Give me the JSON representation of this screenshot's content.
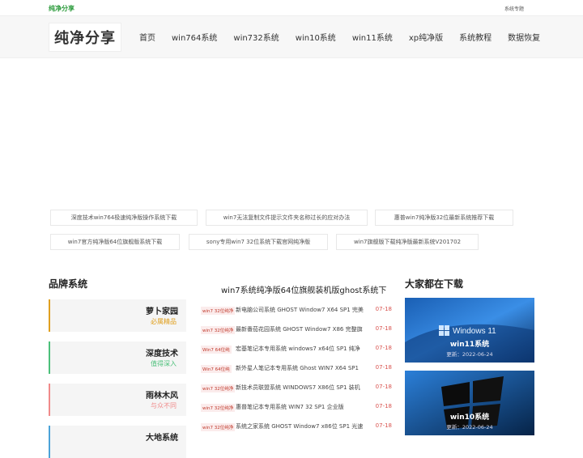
{
  "topbar": {
    "site_name": "纯净分享",
    "special_link": "系统专题"
  },
  "header": {
    "logo": "纯净分享"
  },
  "nav": [
    "首页",
    "win764系统",
    "win732系统",
    "win10系统",
    "win11系统",
    "xp纯净版",
    "系统教程",
    "数据恢复"
  ],
  "tags": [
    "深度技术win764极速纯净版操作系统下载",
    "win7无法复制文件提示文件夹名称过长的应对办法",
    "惠普win7纯净版32位最新系统推荐下载",
    "win7官方纯净版64位旗舰版系统下载",
    "sony专用win7 32位系统下载官网纯净版",
    "win7旗舰版下载纯净版最新系统V201702"
  ],
  "brands": {
    "title": "品牌系统",
    "items": [
      {
        "name": "萝卜家园",
        "sub": "必属精品",
        "color": "#e0a020"
      },
      {
        "name": "深度技术",
        "sub": "值得深入",
        "color": "#4cc07a"
      },
      {
        "name": "雨林木风",
        "sub": "与众不同",
        "color": "#f08a8a"
      },
      {
        "name": "大地系统",
        "sub": "",
        "color": "#4ba3d8"
      }
    ]
  },
  "list": {
    "title": "win7系统纯净版64位旗舰装机版ghost系统下",
    "rows": [
      {
        "badge": "win7 32位纯净",
        "title": "新电脑公司系统 GHOST Window7 X64 SP1 完美",
        "date": "07-18"
      },
      {
        "badge": "win7 32位纯净",
        "title": "最新番茄花园系统 GHOST Window7 X86 完整旗",
        "date": "07-18"
      },
      {
        "badge": "Win7 64位纯",
        "title": "宏基笔记本专用系统 windows7 x64位 SP1 纯净",
        "date": "07-18"
      },
      {
        "badge": "Win7 64位纯",
        "title": "新外星人笔记本专用系统 Ghost WIN7 X64 SP1",
        "date": "07-18"
      },
      {
        "badge": "win7 32位纯净",
        "title": "新技术员联盟系统 WINDOWS7 X86位 SP1 装机",
        "date": "07-18"
      },
      {
        "badge": "win7 32位纯净",
        "title": "惠普笔记本专用系统 WIN7 32 SP1 企业版",
        "date": "07-18"
      },
      {
        "badge": "win7 32位纯净",
        "title": "系统之家系统 GHOST Window7 x86位 SP1 光速",
        "date": "07-18"
      }
    ]
  },
  "downloads": {
    "title": "大家都在下载",
    "items": [
      {
        "name": "win11系统",
        "updated": "更新：2022-06-24",
        "logo_text": "Windows 11"
      },
      {
        "name": "win10系统",
        "updated": "更新：2022-06-24",
        "logo_text": ""
      }
    ]
  }
}
